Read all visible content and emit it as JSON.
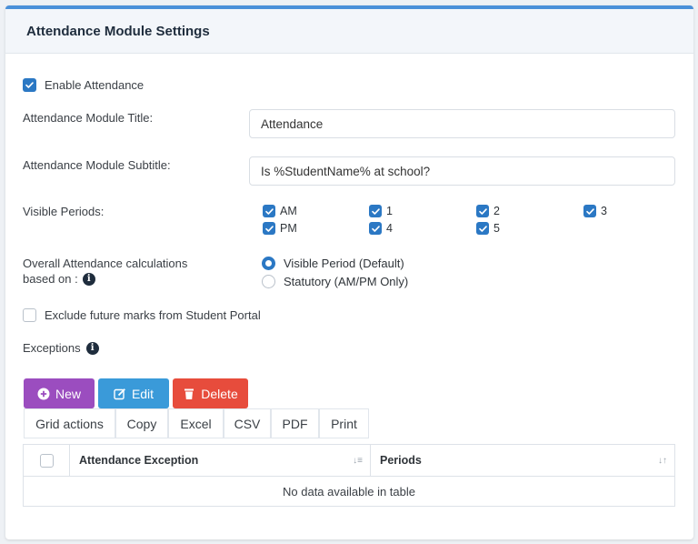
{
  "panel": {
    "title": "Attendance Module Settings"
  },
  "enable": {
    "label": "Enable Attendance",
    "checked": true
  },
  "fields": {
    "title_label": "Attendance Module Title:",
    "title_value": "Attendance",
    "subtitle_label": "Attendance Module Subtitle:",
    "subtitle_value": "Is %StudentName% at school?"
  },
  "periods": {
    "label": "Visible Periods:",
    "items": [
      {
        "label": "AM",
        "checked": true
      },
      {
        "label": "1",
        "checked": true
      },
      {
        "label": "2",
        "checked": true
      },
      {
        "label": "3",
        "checked": true
      },
      {
        "label": "PM",
        "checked": true
      },
      {
        "label": "4",
        "checked": true
      },
      {
        "label": "5",
        "checked": true
      }
    ]
  },
  "calc": {
    "label_line1": "Overall Attendance calculations",
    "label_line2": "based on :",
    "options": [
      {
        "label": "Visible Period (Default)",
        "selected": true
      },
      {
        "label": "Statutory (AM/PM Only)",
        "selected": false
      }
    ]
  },
  "exclude": {
    "label": "Exclude future marks from Student Portal",
    "checked": false
  },
  "exceptions": {
    "label": "Exceptions"
  },
  "buttons": {
    "new": "New",
    "edit": "Edit",
    "delete": "Delete",
    "colors": {
      "new": "#9b4dbf",
      "edit": "#3a9ad9",
      "delete": "#e74c3c"
    }
  },
  "tabs": [
    "Grid actions",
    "Copy",
    "Excel",
    "CSV",
    "PDF",
    "Print"
  ],
  "table": {
    "columns": [
      "Attendance Exception",
      "Periods"
    ],
    "empty": "No data available in table"
  }
}
